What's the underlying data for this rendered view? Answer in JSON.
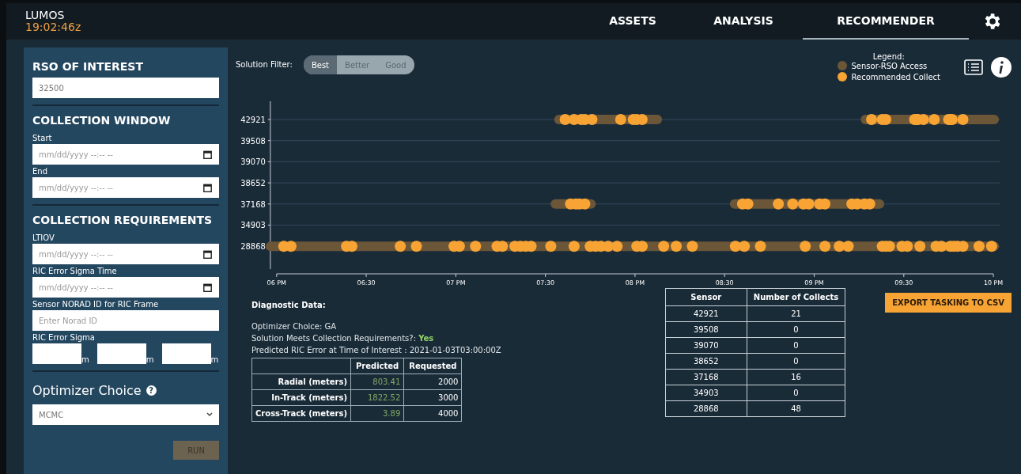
{
  "app": {
    "name": "LUMOS",
    "clock": "19:02:46z"
  },
  "nav": [
    {
      "label": "ASSETS",
      "selected": false
    },
    {
      "label": "ANALYSIS",
      "selected": false
    },
    {
      "label": "RECOMMENDER",
      "selected": true
    }
  ],
  "sidebar": {
    "sections": [
      {
        "title": "RSO OF INTEREST",
        "fields": [
          {
            "kind": "text",
            "value": "32500"
          }
        ]
      },
      {
        "title": "COLLECTION WINDOW",
        "fields": [
          {
            "kind": "date",
            "label": "Start",
            "placeholder": "mm/dd/yyyy --:-- --"
          },
          {
            "kind": "date",
            "label": "End",
            "placeholder": "mm/dd/yyyy --:-- --"
          }
        ]
      },
      {
        "title": "COLLECTION REQUIREMENTS",
        "fields": [
          {
            "kind": "date",
            "label": "LTIOV",
            "placeholder": "mm/dd/yyyy --:-- --"
          },
          {
            "kind": "date",
            "label": "RIC Error Sigma Time",
            "placeholder": "mm/dd/yyyy --:-- --"
          },
          {
            "kind": "text",
            "label": "Sensor NORAD ID for RIC Frame",
            "placeholder": "Enter Norad ID"
          },
          {
            "kind": "triple",
            "label": "RIC Error Sigma",
            "units": [
              "m",
              "m",
              "m"
            ]
          }
        ]
      }
    ],
    "optimizer": {
      "title": "Optimizer Choice",
      "help": "?",
      "value": "MCMC"
    },
    "run_button": {
      "label": "RUN",
      "disabled": true
    }
  },
  "solution_filter": {
    "label": "Solution Filter:",
    "options": [
      {
        "label": "Best",
        "selected": true
      },
      {
        "label": "Better",
        "selected": false
      },
      {
        "label": "Good",
        "selected": false
      }
    ]
  },
  "legend": {
    "title": "Legend:",
    "items": [
      {
        "label": "Sensor-RSO Access",
        "color": "#6b5638"
      },
      {
        "label": "Recommended Collect",
        "color": "#f7a435"
      }
    ]
  },
  "timeline": {
    "sensor_labels": [
      "42921",
      "39508",
      "39070",
      "38652",
      "37168",
      "34903",
      "28868"
    ],
    "time_labels": [
      "06 PM",
      "06:30",
      "07 PM",
      "07:30",
      "08 PM",
      "08:30",
      "09 PM",
      "09:30",
      "10 PM"
    ]
  },
  "diagnostics": {
    "title": "Diagnostic Data:",
    "lines": [
      "Optimizer Choice: GA",
      "Solution Meets Collection Requirements?: **Yes**",
      "Predicted RIC Error at Time of Interest : 2021-01-03T03:00:00Z"
    ],
    "columns": [
      "Predicted",
      "Requested"
    ],
    "rows": [
      {
        "label": "Radial (meters)",
        "predicted": "803.41",
        "requested": "2000"
      },
      {
        "label": "In-Track (meters)",
        "predicted": "1822.52",
        "requested": "3000"
      },
      {
        "label": "Cross-Track (meters)",
        "predicted": "3.89",
        "requested": "4000"
      }
    ]
  },
  "sensor_table": {
    "columns": [
      "Sensor",
      "Number of Collects"
    ],
    "rows": [
      [
        "42921",
        "21"
      ],
      [
        "39508",
        "0"
      ],
      [
        "39070",
        "0"
      ],
      [
        "38652",
        "0"
      ],
      [
        "37168",
        "16"
      ],
      [
        "34903",
        "0"
      ],
      [
        "28868",
        "48"
      ]
    ]
  },
  "export_button": {
    "label": "EXPORT TASKING TO CSV"
  }
}
